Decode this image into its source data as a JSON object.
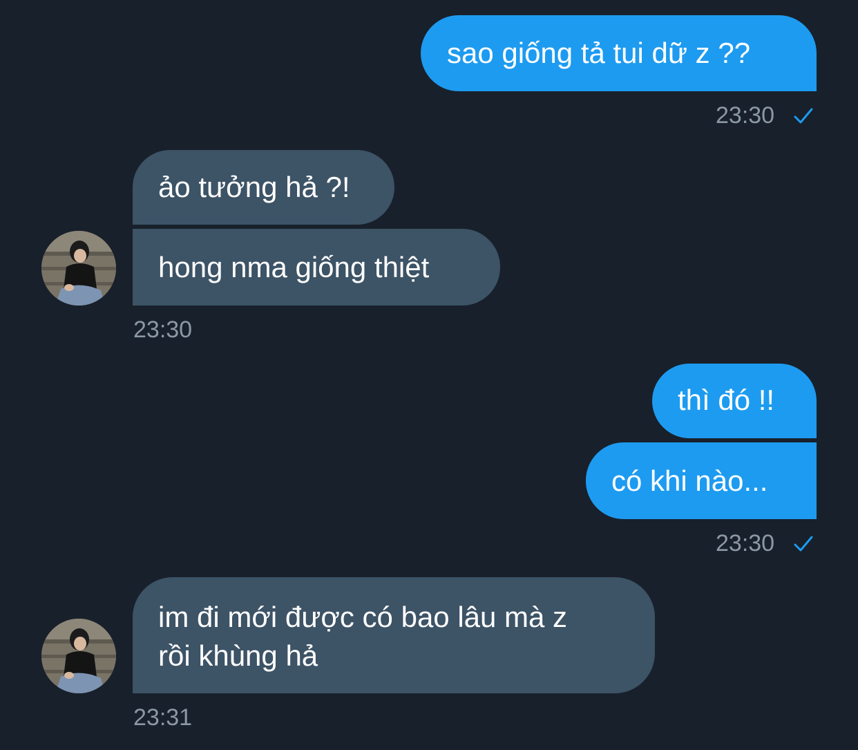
{
  "messages": [
    {
      "id": "m1",
      "direction": "outgoing",
      "text": "sao giống tả tui dữ z ??"
    },
    {
      "id": "m2",
      "direction": "incoming",
      "text": "ảo tưởng hả ?!"
    },
    {
      "id": "m3",
      "direction": "incoming",
      "text": "hong nma giống thiệt"
    },
    {
      "id": "m4",
      "direction": "outgoing",
      "text": "thì đó !!"
    },
    {
      "id": "m5",
      "direction": "outgoing",
      "text": "có khi nào..."
    },
    {
      "id": "m6",
      "direction": "incoming",
      "text_line1": "im đi mới được có bao lâu mà z",
      "text_line2": "rồi khùng hả"
    }
  ],
  "timestamps": {
    "t1": "23:30",
    "t2": "23:30",
    "t3": "23:30",
    "t4": "23:31"
  },
  "icons": {
    "read_receipt": "check-icon",
    "avatar": "avatar"
  },
  "colors": {
    "background": "#18202b",
    "outgoing_bubble": "#1d9bf0",
    "incoming_bubble": "#3d5366",
    "timestamp": "#8b98a5",
    "check": "#1d9bf0"
  }
}
